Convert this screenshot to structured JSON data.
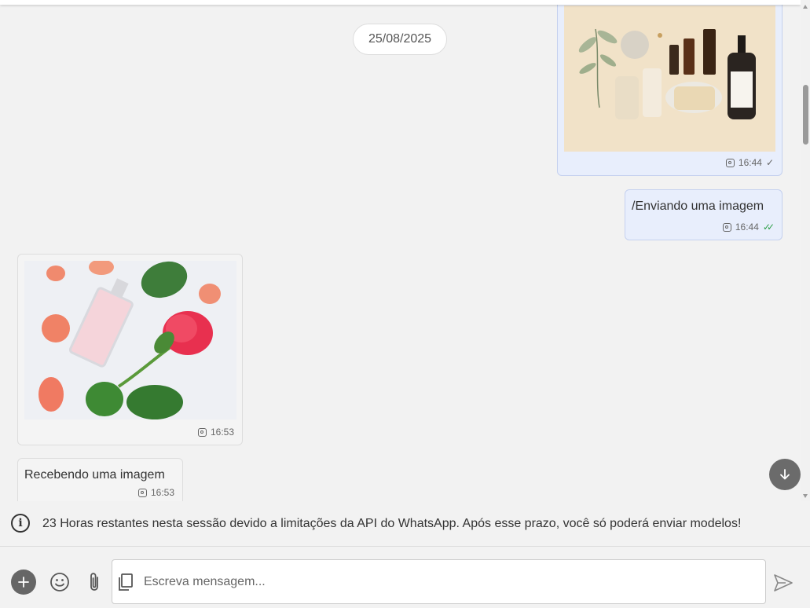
{
  "chat": {
    "date_separator": "25/08/2025",
    "messages": [
      {
        "direction": "out",
        "type": "image",
        "time": "16:44",
        "status": "sent"
      },
      {
        "direction": "out",
        "type": "text",
        "text": "/Enviando uma imagem",
        "time": "16:44",
        "status": "read"
      },
      {
        "direction": "in",
        "type": "image",
        "time": "16:53"
      },
      {
        "direction": "in",
        "type": "text",
        "text": "Recebendo uma imagem",
        "time": "16:53"
      }
    ]
  },
  "session_notice": {
    "text": "23 Horas restantes nesta sessão devido a limitações da API do WhatsApp. Após esse prazo, você só poderá enviar modelos!",
    "icon": "info-icon"
  },
  "composer": {
    "placeholder": "Escreva mensagem...",
    "icons": [
      "plus-icon",
      "emoji-icon",
      "paperclip-icon",
      "copy-icon",
      "send-icon"
    ]
  },
  "colors": {
    "outgoing_bubble": "#e8eefc",
    "incoming_bubble": "#f4f4f4",
    "read_tick": "#2fa04a",
    "fab": "#6b6b6b"
  }
}
